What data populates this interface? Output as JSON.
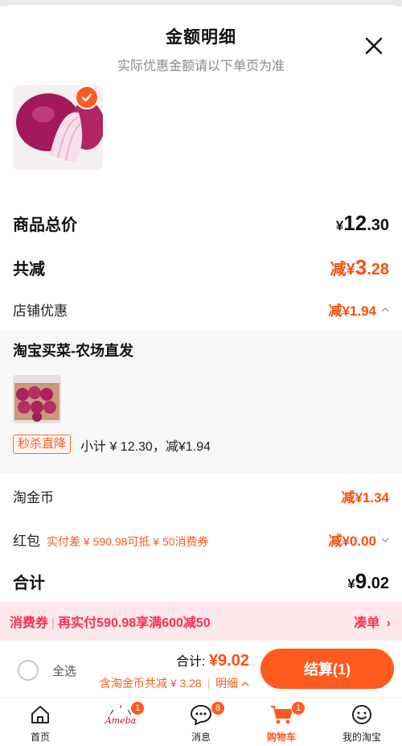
{
  "header": {
    "title": "金额明细",
    "subtitle": "实际优惠金额请以下单页为准"
  },
  "summary": {
    "goods_total_label": "商品总价",
    "goods_total_yen": "¥",
    "goods_total_int": "12",
    "goods_total_dec": ".30",
    "total_discount_label": "共减",
    "total_discount_prefix": "减¥",
    "total_discount_int": "3",
    "total_discount_dec": ".28",
    "shop_discount_label": "店铺优惠",
    "shop_discount_value": "减¥1.94"
  },
  "shop": {
    "name": "淘宝买菜-农场直发",
    "promo_tag": "秒杀直降",
    "promo_text": "小计 ¥ 12.30，减¥1.94"
  },
  "other": {
    "coin_label": "淘金币",
    "coin_value": "减¥1.34",
    "redpack_label": "红包",
    "redpack_note": "实付差 ¥ 590.98可抵 ¥ 50消费券",
    "redpack_value": "减¥0.00",
    "total_label": "合计",
    "total_yen": "¥",
    "total_int": "9",
    "total_dec": ".02"
  },
  "coupon_bar": {
    "tag": "消费券",
    "text": "再实付590.98享满600减50",
    "action": "凑单"
  },
  "checkout": {
    "select_all": "全选",
    "total_prefix": "合计: ",
    "total_value": "¥9.02",
    "coin_note": "含淘金币共减 ¥ 3.28",
    "detail_link": "明细",
    "settle_button": "结算(1)"
  },
  "tabs": [
    {
      "label": "首页",
      "icon": "home-icon"
    },
    {
      "label": "",
      "icon": "promo-logo-icon",
      "badge": "1"
    },
    {
      "label": "消息",
      "icon": "message-icon",
      "badge": "8"
    },
    {
      "label": "购物车",
      "icon": "cart-icon",
      "badge": "1"
    },
    {
      "label": "我的淘宝",
      "icon": "profile-icon"
    }
  ],
  "colors": {
    "accent": "#ff5a1f",
    "discount": "#ff4d0c",
    "coupon_bg": "#fde9ec",
    "coupon_text": "#ff2d4f"
  }
}
